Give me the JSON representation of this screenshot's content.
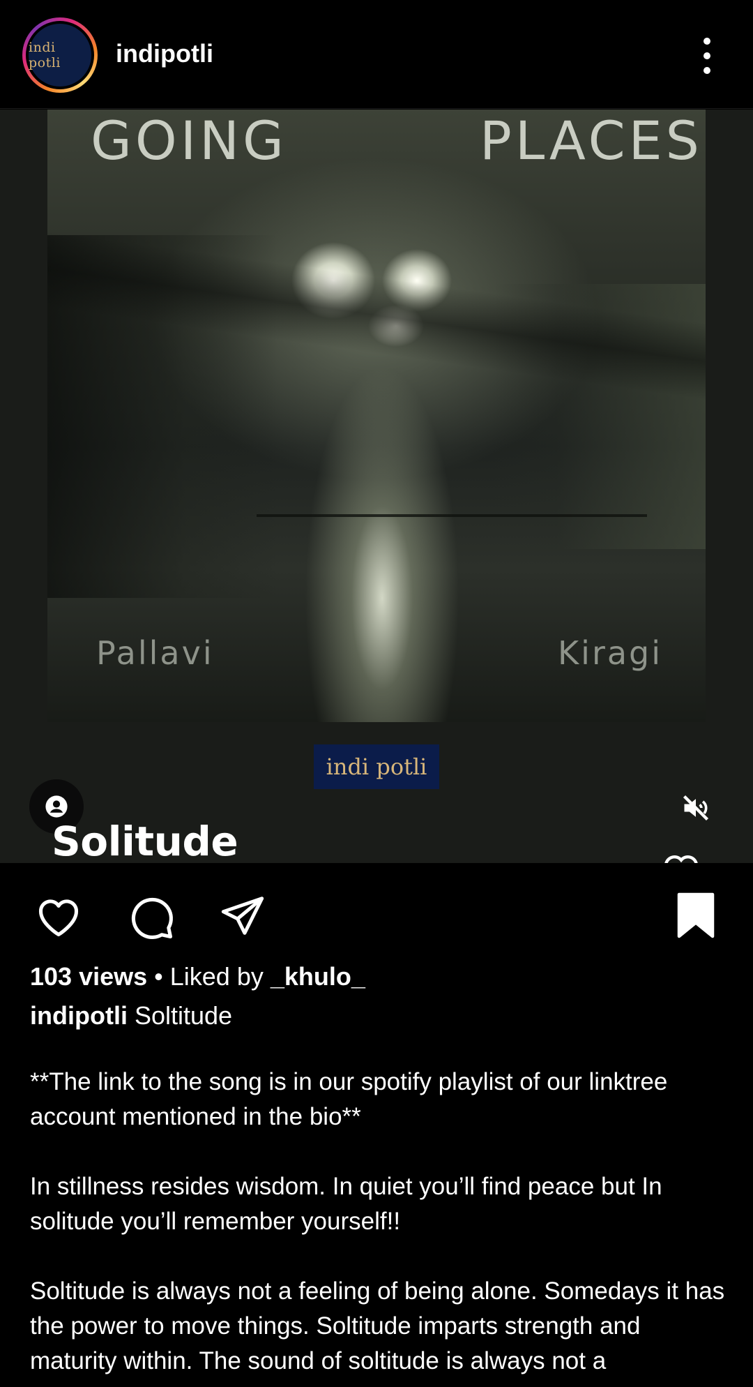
{
  "header": {
    "avatar_text": "indi potli",
    "username": "indipotli"
  },
  "media": {
    "cover_title_left": "GOING",
    "cover_title_right": "PLACES",
    "cover_artist_left": "Pallavi",
    "cover_artist_right": "Kiragi",
    "brand_logo": "indi potli",
    "song_title": "Solitude",
    "muted": true
  },
  "actions": {
    "liked": false,
    "saved": true
  },
  "post": {
    "views": "103 views",
    "separator": " • ",
    "liked_by_prefix": "Liked by ",
    "liked_by_user": "_khulo_",
    "caption_user": "indipotli",
    "caption_title": "Soltitude",
    "paragraphs": [
      "**The link to the song is in our spotify playlist of our linktree account mentioned in the bio**",
      "In stillness resides wisdom. In quiet you’ll find peace but In solitude you’ll remember yourself!!",
      "Soltitude is always not a feeling of being alone. Somedays it has the power to move things. Soltitude imparts strength and maturity within. The sound of soltitude is always not a"
    ]
  },
  "icons": {
    "more": "more-vertical-icon",
    "user_tag": "user-tag-icon",
    "mute": "volume-off-icon",
    "like": "heart-icon",
    "comment": "comment-icon",
    "share": "send-icon",
    "save": "bookmark-icon"
  },
  "colors": {
    "background": "#000000",
    "text": "#ffffff",
    "logo_bg": "#0b1c4a",
    "logo_text": "#d8b67a"
  }
}
